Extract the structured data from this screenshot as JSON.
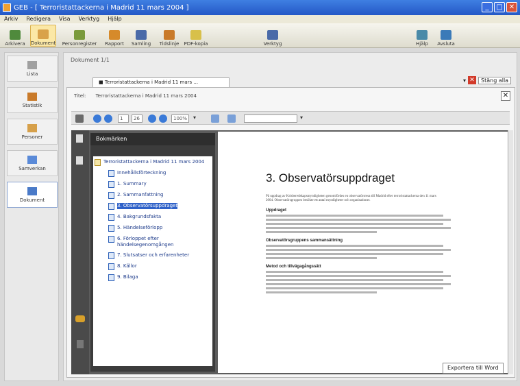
{
  "window": {
    "title": "GEB - [ Terroristattackerna i Madrid 11 mars 2004 ]"
  },
  "menu": [
    "Arkiv",
    "Redigera",
    "Visa",
    "Verktyg",
    "Hjälp"
  ],
  "toolbar": [
    {
      "label": "Arkivera",
      "color": "#4f8a3c"
    },
    {
      "label": "Dokument",
      "color": "#d9a24a",
      "active": true
    },
    {
      "label": "Personregister",
      "color": "#7a9a3c"
    },
    {
      "label": "Rapport",
      "color": "#d68a2a"
    },
    {
      "label": "Samling",
      "color": "#4a6aa8"
    },
    {
      "label": "Tidslinje",
      "color": "#c97a2a"
    },
    {
      "label": "PDF-kopia",
      "color": "#d8c04a"
    },
    {
      "label": "Verktyg",
      "color": "#4a6aa8"
    },
    {
      "label": "Hjälp",
      "color": "#4a8aa8"
    },
    {
      "label": "Avsluta",
      "color": "#3a7ab8"
    }
  ],
  "leftnav": [
    {
      "label": "Lista",
      "color": "#a0a0a0"
    },
    {
      "label": "Statistik",
      "color": "#c97a2a"
    },
    {
      "label": "Personer",
      "color": "#d6a04a"
    },
    {
      "label": "Samverkan",
      "color": "#5a8ad8"
    },
    {
      "label": "Dokument",
      "color": "#4a7ac8",
      "active": true
    }
  ],
  "main": {
    "doc_label": "Dokument 1/1",
    "tab_label": "Terroristattackerna i Madrid 11 mars ...",
    "close_all": "Stäng alla",
    "title_label": "Titel:",
    "title_value": "Terroristattackerna i Madrid 11 mars 2004",
    "export_button": "Exportera till Word"
  },
  "pdf_toolbar": {
    "page_current": "1",
    "page_total": "26",
    "zoom": "100%",
    "search_placeholder": ""
  },
  "bookmarks": {
    "header": "Bokmärken",
    "items": [
      {
        "label": "Terroristattackerna i Madrid 11 mars 2004",
        "level": 0
      },
      {
        "label": "Innehållsförteckning",
        "level": 1
      },
      {
        "label": "1. Summary",
        "level": 1
      },
      {
        "label": "2. Sammanfattning",
        "level": 1
      },
      {
        "label": "3. Observatörsuppdraget",
        "level": 1,
        "selected": true
      },
      {
        "label": "4. Bakgrundsfakta",
        "level": 1
      },
      {
        "label": "5. Händelseförlopp",
        "level": 1
      },
      {
        "label": "6. Förloppet efter händelsegenomgången",
        "level": 1
      },
      {
        "label": "7. Slutsatser och erfarenheter",
        "level": 1
      },
      {
        "label": "8. Källor",
        "level": 1
      },
      {
        "label": "9. Bilaga",
        "level": 1
      }
    ]
  },
  "page": {
    "heading": "3.  Observatörsuppdraget",
    "intro": "På uppdrag av Krisberedskapsmyndigheten genomfördes en observatörsresa till Madrid efter terroristattackerna den 11 mars 2004. Observatörsgruppen besökte ett antal myndigheter och organisationer.",
    "sections": [
      {
        "title": "Uppdraget",
        "lines": 5
      },
      {
        "title": "Observatörsgruppens sammansättning",
        "lines": 4
      },
      {
        "title": "Metod och tillvägagångssätt",
        "lines": 6
      }
    ]
  }
}
